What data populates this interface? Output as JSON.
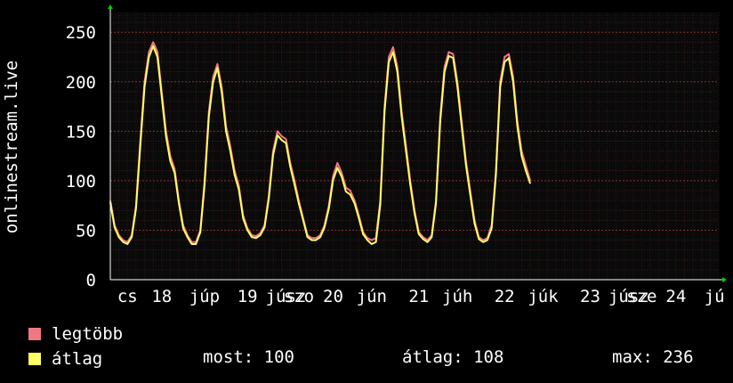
{
  "colors": {
    "background": "#000000",
    "plot_background": "#0a0a0a",
    "grid": "#5a2424",
    "axis": "#ffffff",
    "legtobb": "#f07882",
    "atlag": "#ffff66",
    "arrow": "#00cc00"
  },
  "chart_data": {
    "type": "line",
    "ylabel": "onlinestream.live",
    "ylim": [
      0,
      270
    ],
    "yticks": [
      0,
      50,
      100,
      150,
      200,
      250
    ],
    "grid": true,
    "x_range": [
      0,
      7.1
    ],
    "xtick_labels": [
      {
        "x": 0.2,
        "label": "cs"
      },
      {
        "x": 0.6,
        "label": "18"
      },
      {
        "x": 1.1,
        "label": "júp"
      },
      {
        "x": 1.6,
        "label": "19"
      },
      {
        "x": 2.05,
        "label": "júsz"
      },
      {
        "x": 2.2,
        "label": "szo"
      },
      {
        "x": 2.6,
        "label": "20"
      },
      {
        "x": 3.05,
        "label": "jún"
      },
      {
        "x": 3.6,
        "label": "21"
      },
      {
        "x": 4.05,
        "label": "júh"
      },
      {
        "x": 4.6,
        "label": "22"
      },
      {
        "x": 5.05,
        "label": "júk"
      },
      {
        "x": 5.6,
        "label": "23"
      },
      {
        "x": 6.05,
        "label": "júsz"
      },
      {
        "x": 6.2,
        "label": "sze"
      },
      {
        "x": 6.6,
        "label": "24"
      },
      {
        "x": 7.05,
        "label": "jú"
      }
    ],
    "x": [
      0.0,
      0.05,
      0.1,
      0.15,
      0.2,
      0.25,
      0.3,
      0.35,
      0.4,
      0.45,
      0.5,
      0.55,
      0.6,
      0.65,
      0.7,
      0.75,
      0.8,
      0.85,
      0.9,
      0.95,
      1.0,
      1.05,
      1.1,
      1.15,
      1.2,
      1.25,
      1.3,
      1.35,
      1.4,
      1.45,
      1.5,
      1.55,
      1.6,
      1.65,
      1.7,
      1.75,
      1.8,
      1.85,
      1.9,
      1.95,
      2.0,
      2.05,
      2.1,
      2.15,
      2.2,
      2.25,
      2.3,
      2.35,
      2.4,
      2.45,
      2.5,
      2.55,
      2.6,
      2.65,
      2.7,
      2.75,
      2.8,
      2.85,
      2.9,
      2.95,
      3.0,
      3.05,
      3.1,
      3.15,
      3.2,
      3.25,
      3.3,
      3.35,
      3.4,
      3.45,
      3.5,
      3.55,
      3.6,
      3.65,
      3.7,
      3.75,
      3.8,
      3.85,
      3.9,
      3.95,
      4.0,
      4.05,
      4.1,
      4.15,
      4.2,
      4.25,
      4.3,
      4.35,
      4.4,
      4.45,
      4.5,
      4.55,
      4.6,
      4.65,
      4.7,
      4.75,
      4.8,
      4.85,
      4.9,
      4.95,
      5.0,
      5.05,
      5.1,
      5.15,
      5.2,
      5.25,
      5.3,
      5.35,
      5.4,
      5.45,
      5.5,
      5.55,
      5.6,
      5.65,
      5.7,
      5.75,
      5.8,
      5.85,
      5.9,
      5.95,
      6.0,
      6.05,
      6.1,
      6.15,
      6.2,
      6.25,
      6.3,
      6.35,
      6.4,
      6.45,
      6.5,
      6.55,
      6.6,
      6.65,
      6.7,
      6.75,
      6.8,
      6.85,
      6.9,
      6.95,
      7.0,
      7.05
    ],
    "series": [
      {
        "name": "legtöbb",
        "values": [
          80,
          55,
          45,
          40,
          38,
          45,
          75,
          140,
          200,
          230,
          240,
          230,
          190,
          150,
          125,
          112,
          80,
          55,
          45,
          38,
          38,
          50,
          100,
          170,
          205,
          218,
          195,
          155,
          135,
          110,
          95,
          65,
          52,
          45,
          44,
          47,
          55,
          85,
          130,
          150,
          145,
          142,
          118,
          100,
          80,
          62,
          45,
          42,
          42,
          45,
          55,
          75,
          105,
          118,
          108,
          93,
          90,
          80,
          65,
          48,
          42,
          40,
          42,
          80,
          175,
          225,
          235,
          215,
          170,
          135,
          100,
          70,
          48,
          43,
          40,
          45,
          80,
          165,
          215,
          230,
          228,
          200,
          160,
          120,
          90,
          60,
          43,
          40,
          42,
          55,
          110,
          200,
          225,
          228,
          205,
          160,
          130,
          115,
          100
        ]
      },
      {
        "name": "átlag",
        "values": [
          78,
          53,
          43,
          38,
          36,
          43,
          72,
          135,
          195,
          225,
          236,
          225,
          185,
          145,
          120,
          108,
          77,
          52,
          43,
          36,
          36,
          48,
          96,
          165,
          200,
          214,
          190,
          150,
          130,
          106,
          91,
          62,
          50,
          43,
          42,
          45,
          53,
          82,
          126,
          146,
          141,
          138,
          114,
          96,
          77,
          60,
          43,
          40,
          40,
          43,
          53,
          72,
          101,
          113,
          104,
          89,
          86,
          77,
          62,
          46,
          40,
          36,
          38,
          76,
          170,
          220,
          230,
          210,
          165,
          130,
          96,
          67,
          46,
          41,
          38,
          43,
          77,
          160,
          210,
          226,
          224,
          195,
          155,
          116,
          86,
          57,
          41,
          38,
          40,
          52,
          106,
          195,
          220,
          224,
          200,
          155,
          125,
          110,
          97
        ]
      }
    ]
  },
  "legend": {
    "items": [
      {
        "label": "legtöbb"
      },
      {
        "label": "átlag"
      }
    ]
  },
  "stats": {
    "now": "most: 100",
    "avg": "átlag: 108",
    "max": "max: 236"
  }
}
